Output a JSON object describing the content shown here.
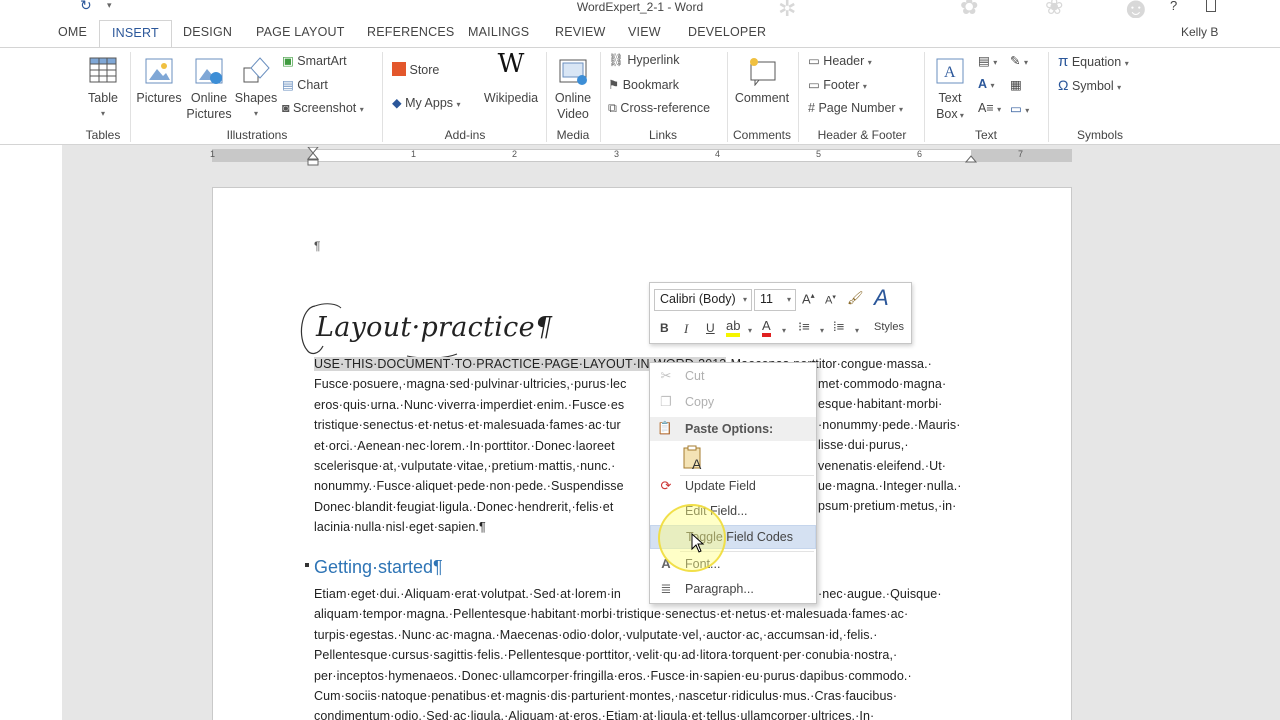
{
  "window": {
    "title": "WordExpert_2-1 - Word",
    "user": "Kelly B",
    "help_label": "?"
  },
  "tabs": [
    {
      "label": "OME",
      "active": false
    },
    {
      "label": "INSERT",
      "active": true
    },
    {
      "label": "DESIGN",
      "active": false
    },
    {
      "label": "PAGE LAYOUT",
      "active": false
    },
    {
      "label": "REFERENCES",
      "active": false
    },
    {
      "label": "MAILINGS",
      "active": false
    },
    {
      "label": "REVIEW",
      "active": false
    },
    {
      "label": "VIEW",
      "active": false
    },
    {
      "label": "DEVELOPER",
      "active": false
    }
  ],
  "ribbon": {
    "groups": {
      "tables": "Tables",
      "illustrations": "Illustrations",
      "addins": "Add-ins",
      "media": "Media",
      "links": "Links",
      "comments": "Comments",
      "header_footer": "Header & Footer",
      "text": "Text",
      "symbols": "Symbols"
    },
    "buttons": {
      "table": "Table",
      "pictures": "Pictures",
      "online_pictures_1": "Online",
      "online_pictures_2": "Pictures",
      "shapes": "Shapes",
      "smartart": "SmartArt",
      "chart": "Chart",
      "screenshot": "Screenshot",
      "store": "Store",
      "my_apps": "My Apps",
      "wikipedia": "Wikipedia",
      "online_video_1": "Online",
      "online_video_2": "Video",
      "hyperlink": "Hyperlink",
      "bookmark": "Bookmark",
      "cross_reference": "Cross-reference",
      "comment": "Comment",
      "header": "Header",
      "footer": "Footer",
      "page_number": "Page Number",
      "text_box_1": "Text",
      "text_box_2": "Box",
      "equation": "Equation",
      "symbol": "Symbol"
    }
  },
  "ruler": {
    "numbers": [
      "1",
      "1",
      "2",
      "3",
      "4",
      "5",
      "6",
      "7"
    ]
  },
  "document": {
    "empty_para": "¶",
    "title": "Layout·practice¶",
    "para1_highlight": "USE·THIS·DOCUMENT·TO·PRACTICE·PAGE·LAYOUT·IN·WORD·2013",
    "para1_lines": [
      "·Maecenas·porttitor·congue·massa.·",
      "Fusce·posuere,·magna·sed·pulvinar·ultricies,·purus·lec",
      "eros·quis·urna.·Nunc·viverra·imperdiet·enim.·Fusce·es",
      "tristique·senectus·et·netus·et·malesuada·fames·ac·tur",
      "et·orci.·Aenean·nec·lorem.·In·porttitor.·Donec·laoreet",
      "scelerisque·at,·vulputate·vitae,·pretium·mattis,·nunc.·",
      "nonummy.·Fusce·aliquet·pede·non·pede.·Suspendisse",
      "Donec·blandit·feugiat·ligula.·Donec·hendrerit,·felis·et",
      "lacinia·nulla·nisl·eget·sapien.¶"
    ],
    "para1_right": [
      "",
      "met·commodo·magna·",
      "esque·habitant·morbi·",
      "·nonummy·pede.·Mauris·",
      "lisse·dui·purus,·",
      "venenatis·eleifend.·Ut·",
      "ue·magna.·Integer·nulla.·",
      "psum·pretium·metus,·in·",
      ""
    ],
    "heading": "Getting·started¶",
    "para2_lines": [
      "Etiam·eget·dui.·Aliquam·erat·volutpat.·Sed·at·lorem·in",
      "aliquam·tempor·magna.·Pellentesque·habitant·morbi·tristique·senectus·et·netus·et·malesuada·fames·ac·",
      "turpis·egestas.·Nunc·ac·magna.·Maecenas·odio·dolor,·vulputate·vel,·auctor·ac,·accumsan·id,·felis.·",
      "Pellentesque·cursus·sagittis·felis.·Pellentesque·porttitor,·velit·qu·ad·litora·torquent·per·conubia·nostra,·",
      "per·inceptos·hymenaeos.·Donec·ullamcorper·fringilla·eros.·Fusce·in·sapien·eu·purus·dapibus·commodo.·",
      "Cum·sociis·natoque·penatibus·et·magnis·dis·parturient·montes,·nascetur·ridiculus·mus.·Cras·faucibus·",
      "condimentum·odio.·Sed·ac·ligula.·Aliquam·at·eros.·Etiam·at·ligula·et·tellus·ullamcorper·ultrices.·In·"
    ],
    "para2_right_first": "·nec·augue.·Quisque·"
  },
  "mini_toolbar": {
    "font": "Calibri (Body)",
    "size": "11",
    "bold": "B",
    "italic": "I",
    "underline": "U",
    "styles": "Styles"
  },
  "context_menu": {
    "cut": "Cut",
    "copy": "Copy",
    "paste_options": "Paste Options:",
    "update_field": "Update Field",
    "edit_field": "Edit Field...",
    "toggle_field_codes": "Toggle Field Codes",
    "font": "Font...",
    "paragraph": "Paragraph..."
  }
}
